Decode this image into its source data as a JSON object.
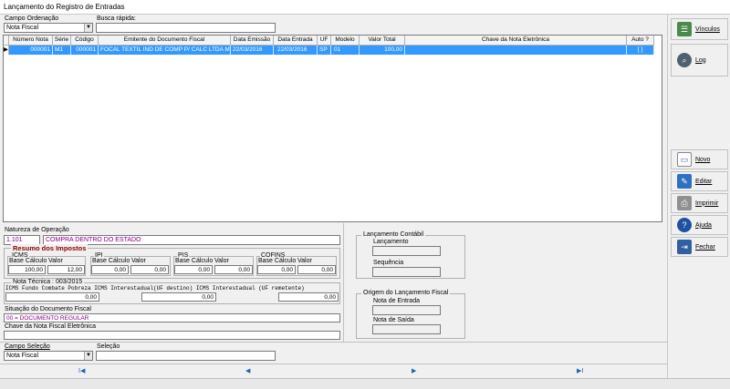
{
  "window": {
    "title": "Lançamento do Registro de Entradas"
  },
  "top": {
    "campo_ordenacao_label": "Campo Ordenação",
    "campo_ordenacao_value": "Nota Fiscal",
    "busca_rapida_label": "Busca rápida:",
    "busca_rapida_value": ""
  },
  "grid": {
    "headers": [
      "Número Nota",
      "Série",
      "Código",
      "Emitente do Documento Fiscal",
      "Data Emissão",
      "Data Entrada",
      "UF",
      "Modelo",
      "Valor Total",
      "Chave da Nota Eletrônica",
      "Auto ?"
    ],
    "row": [
      "000001",
      "M1",
      "000001",
      "FOCAL TEXTIL IND DE COMP P/ CALC LTDA M",
      "22/03/2016",
      "22/03/2016",
      "SP",
      "01",
      "100,00",
      "",
      "[ ]"
    ]
  },
  "sidebar": {
    "vinculos": "Vínculos",
    "log": "Log",
    "novo": "Novo",
    "editar": "Editar",
    "imprimir": "Imprimir",
    "ajuda": "Ajuda",
    "fechar": "Fechar"
  },
  "natureza": {
    "label": "Natureza de Operação",
    "code": "1.101",
    "desc": "COMPRA DENTRO DO ESTADO"
  },
  "impostos": {
    "title": "Resumo dos Impostos",
    "base_label": "Base Cálculo",
    "valor_label": "Valor",
    "icms": {
      "name": "ICMS",
      "base": "100,00",
      "valor": "12,00"
    },
    "ipi": {
      "name": "IPI",
      "base": "0,00",
      "valor": "0,00"
    },
    "pis": {
      "name": "PIS",
      "base": "0,00",
      "valor": "0,00"
    },
    "cofins": {
      "name": "COFINS",
      "base": "0,00",
      "valor": "0,00"
    }
  },
  "nota_tecnica": {
    "title": "Nota Técnica : 003/2015",
    "labels": "ICMS Fundo Combate Pobreza ICMS Interestadual(UF destino) ICMS Interestadual (UF remetente)",
    "v1": "0,00",
    "v2": "0,00",
    "v3": "0,00"
  },
  "situacao": {
    "label": "Situação do Documento Fiscal",
    "value": "00 = DOCUMENTO REGULAR"
  },
  "chave": {
    "label": "Chave da Nota Fiscal Eletrônica",
    "value": ""
  },
  "contabil": {
    "title": "Lançamento Contábil",
    "lancamento": "Lançamento",
    "sequencia": "Sequência"
  },
  "origem": {
    "title": "Origem do Lançamento Fiscal",
    "entrada": "Nota de Entrada",
    "saida": "Nota de Saída"
  },
  "bottom": {
    "campo_selecao_label": "Campo Seleção",
    "campo_selecao_value": "Nota Fiscal",
    "selecao_label": "Seleção",
    "selecao_value": ""
  },
  "nav": {
    "first": "I◀",
    "prev": "◀",
    "next": "▶",
    "last": "▶I"
  }
}
